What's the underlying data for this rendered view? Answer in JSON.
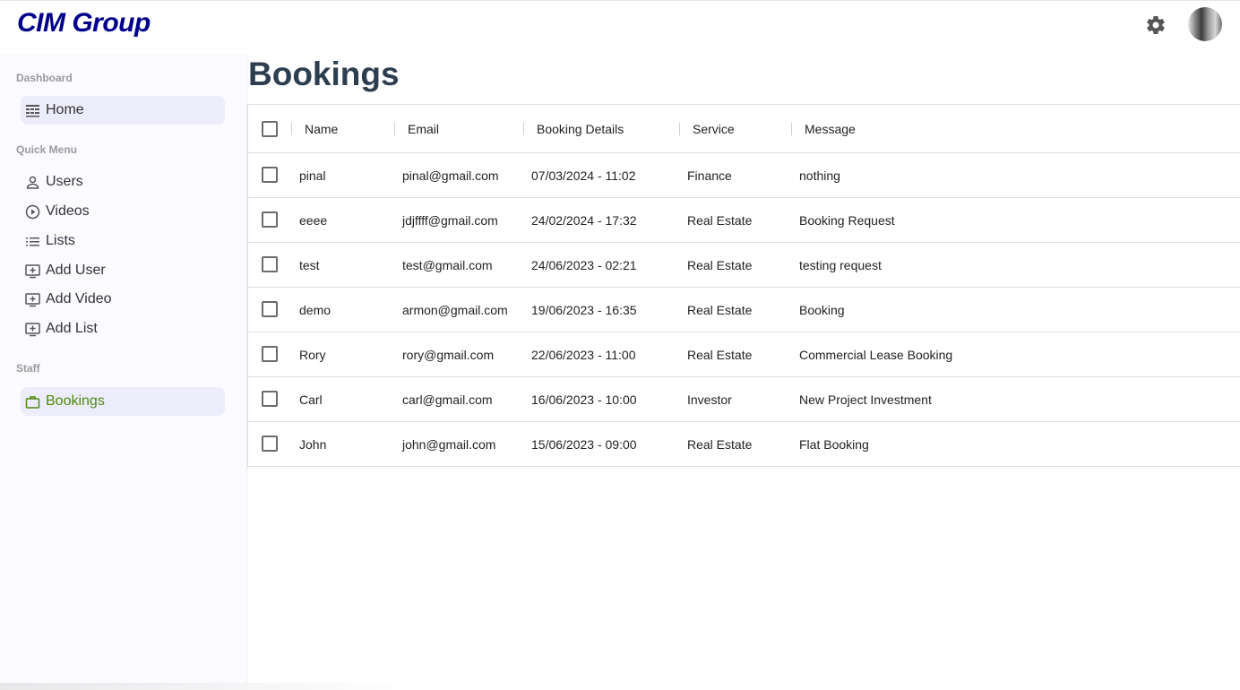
{
  "app": {
    "logo": "CIM Group"
  },
  "header": {
    "settings_icon": "gear-icon",
    "avatar": "avatar"
  },
  "sidebar": {
    "sections": {
      "dashboard": "Dashboard",
      "quick_menu": "Quick Menu",
      "staff": "Staff"
    },
    "home": "Home",
    "users": "Users",
    "videos": "Videos",
    "lists": "Lists",
    "add_user": "Add User",
    "add_video": "Add Video",
    "add_list": "Add List",
    "bookings": "Bookings"
  },
  "page": {
    "title": "Bookings"
  },
  "table": {
    "columns": {
      "name": "Name",
      "email": "Email",
      "booking_details": "Booking Details",
      "service": "Service",
      "message": "Message"
    },
    "rows": [
      {
        "name": "pinal",
        "email": "pinal@gmail.com",
        "booking": "07/03/2024 - 11:02",
        "service": "Finance",
        "message": "nothing"
      },
      {
        "name": "eeee",
        "email": "jdjffff@gmail.com",
        "booking": "24/02/2024 - 17:32",
        "service": "Real Estate",
        "message": "Booking Request"
      },
      {
        "name": "test",
        "email": "test@gmail.com",
        "booking": "24/06/2023 - 02:21",
        "service": "Real Estate",
        "message": "testing request"
      },
      {
        "name": "demo",
        "email": "armon@gmail.com",
        "booking": "19/06/2023 - 16:35",
        "service": "Real Estate",
        "message": "Booking"
      },
      {
        "name": "Rory",
        "email": "rory@gmail.com",
        "booking": "22/06/2023 - 11:00",
        "service": "Real Estate",
        "message": "Commercial Lease Booking"
      },
      {
        "name": "Carl",
        "email": "carl@gmail.com",
        "booking": "16/06/2023 - 10:00",
        "service": "Investor",
        "message": "New Project Investment"
      },
      {
        "name": "John",
        "email": "john@gmail.com",
        "booking": "15/06/2023 - 09:00",
        "service": "Real Estate",
        "message": "Flat Booking"
      }
    ]
  },
  "colors": {
    "logo": "#00008b",
    "title": "#2c3e50",
    "active_green": "#4f8a10",
    "active_bg": "#ececfa"
  }
}
